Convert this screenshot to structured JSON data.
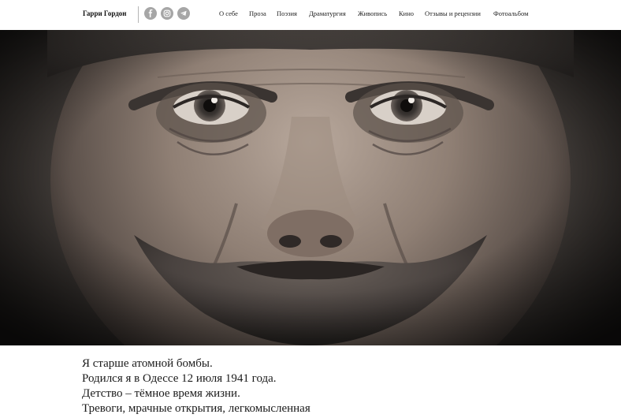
{
  "header": {
    "brand": "Гарри Гордон",
    "socials": [
      {
        "name": "facebook-icon",
        "color": "#a6a6a6"
      },
      {
        "name": "instagram-icon",
        "color": "#a6a6a6"
      },
      {
        "name": "telegram-icon",
        "color": "#a6a6a6"
      }
    ],
    "nav": [
      {
        "label": "О себе"
      },
      {
        "label": "Проза"
      },
      {
        "label": "Поэзия"
      },
      {
        "label": "Драматургия"
      },
      {
        "label": "Живопись"
      },
      {
        "label": "Кино"
      },
      {
        "label": "Отзывы и рецензии"
      },
      {
        "label": "Фотоальбом"
      }
    ]
  },
  "hero": {
    "image": "portrait-photo"
  },
  "poem": {
    "lines": [
      "Я старше атомной бомбы.",
      "Родился я в Одессе 12 июля 1941 года.",
      "Детство – тёмное время жизни.",
      "Тревоги, мрачные открытия, легкомысленная"
    ]
  },
  "colors": {
    "background": "#ffffff",
    "text": "#1a1a1a",
    "icon": "#a6a6a6",
    "divider": "#b5b5b5"
  }
}
